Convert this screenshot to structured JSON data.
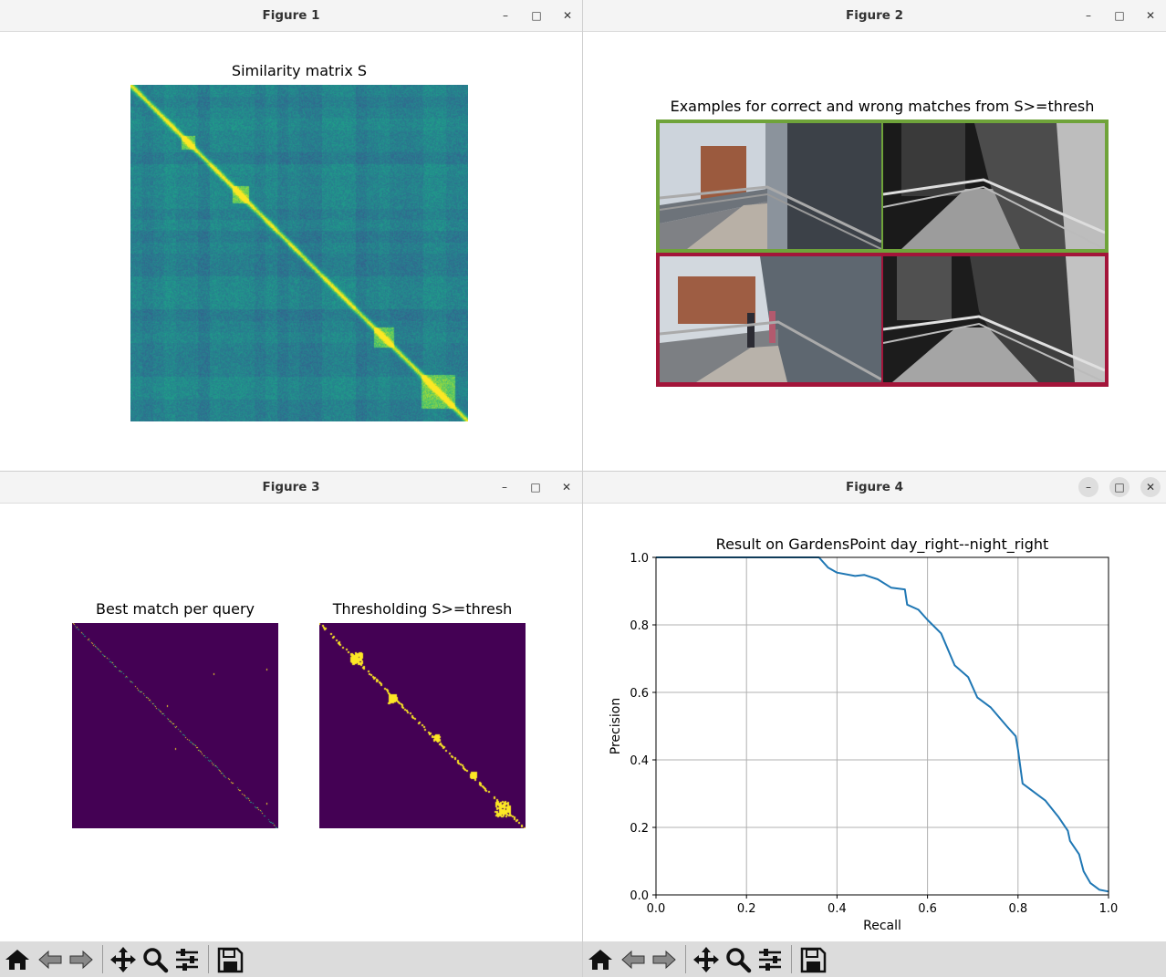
{
  "windows": {
    "fig1": {
      "title": "Figure 1"
    },
    "fig2": {
      "title": "Figure 2"
    },
    "fig3": {
      "title": "Figure 3"
    },
    "fig4": {
      "title": "Figure 4"
    }
  },
  "window_controls": {
    "minimize": "–",
    "maximize": "□",
    "close": "✕"
  },
  "toolbar_icons": [
    "home-icon",
    "back-icon",
    "forward-icon",
    "pan-icon",
    "zoom-icon",
    "configure-subplots-icon",
    "save-icon"
  ],
  "fig1": {
    "title": "Similarity matrix S",
    "colormap": "viridis"
  },
  "fig2": {
    "title": "Examples for correct and wrong matches from S>=thresh",
    "correct_border_color": "#6fa33a",
    "wrong_border_color": "#a3153a"
  },
  "fig3": {
    "left_title": "Best match per query",
    "right_title": "Thresholding S>=thresh",
    "background_color": "#440154",
    "foreground_color": "#fde725"
  },
  "chart_data": {
    "type": "line",
    "title": "Result on GardensPoint day_right--night_right",
    "xlabel": "Recall",
    "ylabel": "Precision",
    "xlim": [
      0.0,
      1.0
    ],
    "ylim": [
      0.0,
      1.0
    ],
    "xticks": [
      "0.0",
      "0.2",
      "0.4",
      "0.6",
      "0.8",
      "1.0"
    ],
    "yticks": [
      "0.0",
      "0.2",
      "0.4",
      "0.6",
      "0.8",
      "1.0"
    ],
    "grid": true,
    "series": [
      {
        "color": "#1f77b4",
        "x": [
          0.0,
          0.36,
          0.38,
          0.4,
          0.44,
          0.46,
          0.49,
          0.52,
          0.55,
          0.555,
          0.58,
          0.6,
          0.63,
          0.66,
          0.69,
          0.71,
          0.74,
          0.775,
          0.795,
          0.8,
          0.81,
          0.83,
          0.86,
          0.89,
          0.91,
          0.915,
          0.935,
          0.945,
          0.96,
          0.98,
          1.0
        ],
        "y": [
          1.0,
          1.0,
          0.97,
          0.955,
          0.945,
          0.948,
          0.935,
          0.91,
          0.905,
          0.86,
          0.845,
          0.815,
          0.775,
          0.68,
          0.645,
          0.585,
          0.555,
          0.5,
          0.47,
          0.43,
          0.33,
          0.31,
          0.28,
          0.23,
          0.19,
          0.16,
          0.12,
          0.07,
          0.035,
          0.015,
          0.01
        ]
      }
    ]
  }
}
